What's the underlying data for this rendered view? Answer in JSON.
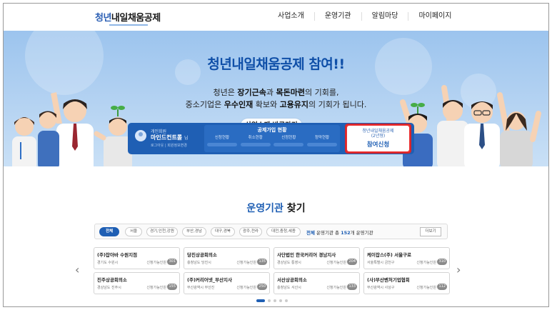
{
  "header": {
    "logo_part1": "청년",
    "logo_part2": "내일채움공제",
    "nav": [
      "사업소개",
      "운영기관",
      "알림마당",
      "마이페이지"
    ]
  },
  "hero": {
    "title": "청년내일채움공제 참여!!",
    "line1_pre": "청년은 ",
    "line1_b1": "장기근속",
    "line1_mid": "과 ",
    "line1_b2": "목돈마련",
    "line1_post": "의 기회를,",
    "line2_pre": "중소기업은 ",
    "line2_b1": "우수인재",
    "line2_mid": " 확보와 ",
    "line2_b2": "고용유지",
    "line2_post": "의 기회가 됩니다.",
    "button": "사업소개 바로가기"
  },
  "panel": {
    "user_type": "개인회원",
    "user_name": "마인드컨트롤",
    "user_suffix": "님",
    "user_sub": "로그아웃 | 회원정보변경",
    "status_title": "공제가입 현황",
    "status_items": [
      "신청현황",
      "취소현황",
      "신청현황",
      "청약현황"
    ],
    "apply_sub": "청년내일채움공제\n(2년형)",
    "apply_main": "참여신청"
  },
  "section": {
    "title_accent": "운영기관",
    "title_rest": " 찾기",
    "filters": [
      "전체",
      "서울",
      "경기,인천,강원",
      "부산,경남",
      "대구,경북",
      "광주,전라",
      "대전,충청,세종"
    ],
    "count_pre": "전체",
    "count_mid": " 운영기관 총 ",
    "count_num": "152",
    "count_post": "개 운영기관",
    "more": "더보기"
  },
  "cards": [
    {
      "name": "(주)잡아바 수원지점",
      "loc": "경기도 수원시",
      "ready": "신청가능인원",
      "num": "301"
    },
    {
      "name": "당진상공회의소",
      "loc": "충청남도 당진시",
      "ready": "신청가능인원",
      "num": "135"
    },
    {
      "name": "사단법인 한국커리어 경남지사",
      "loc": "경상남도 통영시",
      "ready": "신청가능인원",
      "num": "204"
    },
    {
      "name": "케이잡스(주) 서울구로",
      "loc": "서울특별시 금천구",
      "ready": "신청가능인원",
      "num": "310"
    },
    {
      "name": "진주상공회의소",
      "loc": "경상남도 진주시",
      "ready": "신청가능인원",
      "num": "155"
    },
    {
      "name": "(주)커리어넷_부산지사",
      "loc": "부산광역시 부산진",
      "ready": "신청가능인원",
      "num": "250"
    },
    {
      "name": "서산상공회의소",
      "loc": "충청남도 서산시",
      "ready": "신청가능인원",
      "num": "133"
    },
    {
      "name": "(사)부산벤처기업협회",
      "loc": "부산광역시 사상구",
      "ready": "신청가능인원",
      "num": "112"
    }
  ],
  "colors": {
    "primary": "#1f5fb4",
    "highlight": "#d8262c"
  }
}
